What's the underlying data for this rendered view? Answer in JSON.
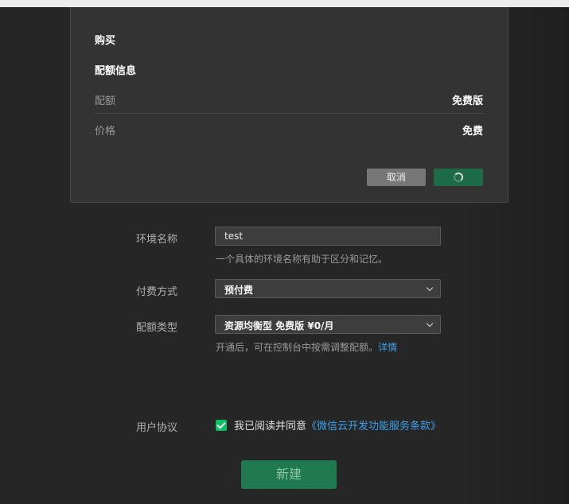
{
  "modal": {
    "title": "购买",
    "section_title": "配额信息",
    "rows": [
      {
        "label": "配额",
        "value": "免费版"
      },
      {
        "label": "价格",
        "value": "免费"
      }
    ],
    "cancel_label": "取消"
  },
  "form": {
    "env_name": {
      "label": "环境名称",
      "value": "test",
      "help": "一个具体的环境名称有助于区分和记忆。"
    },
    "payment": {
      "label": "付费方式",
      "value": "预付费"
    },
    "quota": {
      "label": "配额类型",
      "value": "资源均衡型 免费版 ¥0/月",
      "help": "开通后，可在控制台中按需调整配额。",
      "help_link": "详情"
    },
    "agreement": {
      "label": "用户协议",
      "text": "我已阅读并同意",
      "link": "《微信云开发功能服务条款》",
      "checked": true
    },
    "create_label": "新建"
  },
  "colors": {
    "accent": "#07c160",
    "button_green": "#1f7a52",
    "link": "#3ea0ea"
  }
}
